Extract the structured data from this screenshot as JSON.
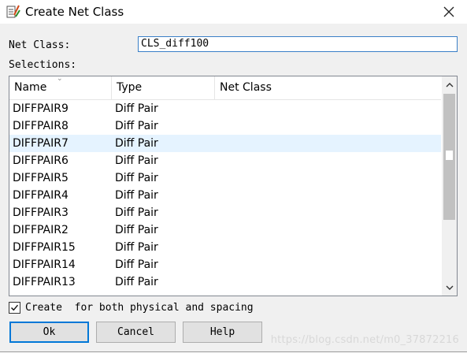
{
  "window": {
    "title": "Create Net Class",
    "close_icon": "close-icon"
  },
  "form": {
    "net_class_label": "Net Class:",
    "net_class_value": "CLS_diff100",
    "selections_label": "Selections:"
  },
  "list": {
    "columns": [
      "Name",
      "Type",
      "Net Class"
    ],
    "rows": [
      {
        "name": "DIFFPAIR9",
        "type": "Diff Pair",
        "net_class": ""
      },
      {
        "name": "DIFFPAIR8",
        "type": "Diff Pair",
        "net_class": ""
      },
      {
        "name": "DIFFPAIR7",
        "type": "Diff Pair",
        "net_class": ""
      },
      {
        "name": "DIFFPAIR6",
        "type": "Diff Pair",
        "net_class": ""
      },
      {
        "name": "DIFFPAIR5",
        "type": "Diff Pair",
        "net_class": ""
      },
      {
        "name": "DIFFPAIR4",
        "type": "Diff Pair",
        "net_class": ""
      },
      {
        "name": "DIFFPAIR3",
        "type": "Diff Pair",
        "net_class": ""
      },
      {
        "name": "DIFFPAIR2",
        "type": "Diff Pair",
        "net_class": ""
      },
      {
        "name": "DIFFPAIR15",
        "type": "Diff Pair",
        "net_class": ""
      },
      {
        "name": "DIFFPAIR14",
        "type": "Diff Pair",
        "net_class": ""
      },
      {
        "name": "DIFFPAIR13",
        "type": "Diff Pair",
        "net_class": ""
      }
    ],
    "selected_row": "DIFFPAIR7"
  },
  "options": {
    "create_checkbox_checked": true,
    "create_label": "Create  for both physical and spacing"
  },
  "buttons": {
    "ok": "Ok",
    "cancel": "Cancel",
    "help": "Help"
  },
  "watermark": "https://blog.csdn.net/m0_37872216",
  "colors": {
    "accent": "#0078d7",
    "selected_row": "#e5f3ff",
    "input_border": "#3a7fc7"
  }
}
